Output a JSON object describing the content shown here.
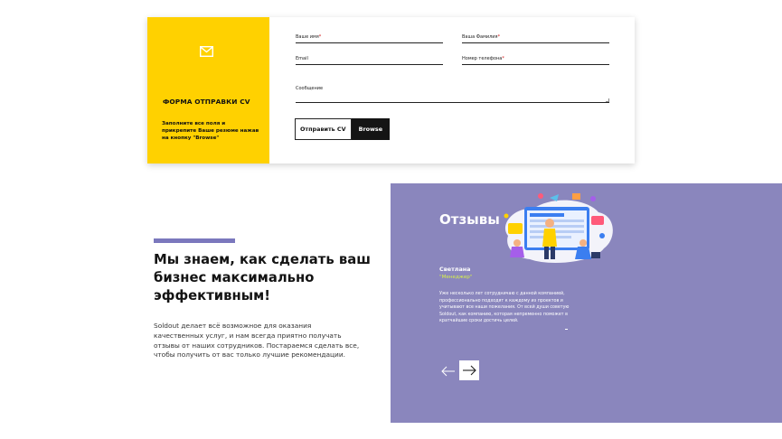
{
  "cv_form": {
    "title": "ФОРМА ОТПРАВКИ CV",
    "description": "Заполните все поля и прикрепите Ваше резюме нажав на кнопку \"Browse\"",
    "icon": "mail-icon",
    "fields": {
      "name_label": "Ваше имя",
      "surname_label": "Ваша Фамилия",
      "email_label": "Email",
      "phone_label": "Номер телефона",
      "message_label": "Сообщение",
      "required_mark": "*"
    },
    "send_label": "Отправить CV",
    "browse_label": "Browse"
  },
  "promo": {
    "heading": "Мы знаем, как сделать ваш бизнес максимально эффективным!",
    "text": "Soldout делает всё возможное для оказания качественных услуг, и нам всегда приятно получать отзывы от наших сотрудников. Постараемся сделать все, чтобы получить от вас только лучшие рекомендации."
  },
  "reviews": {
    "title": "Отзывы",
    "name": "Светлана",
    "role": "\"Менеджер\"",
    "text": "Уже несколько лет сотрудничаю с данной компанией, профессионально подходят к каждому из проектов и учитывают все наши пожелания. От всей души советую Soldout, как компанию, которая непременно поможет в кратчайшие сроки достичь целей.",
    "prev_icon": "arrow-left-icon",
    "next_icon": "arrow-right-icon"
  },
  "colors": {
    "yellow": "#ffd100",
    "purple_panel": "#8a86bd",
    "accent_bar": "#7b78bd",
    "role_color": "#d7f04a",
    "dark": "#141414"
  }
}
